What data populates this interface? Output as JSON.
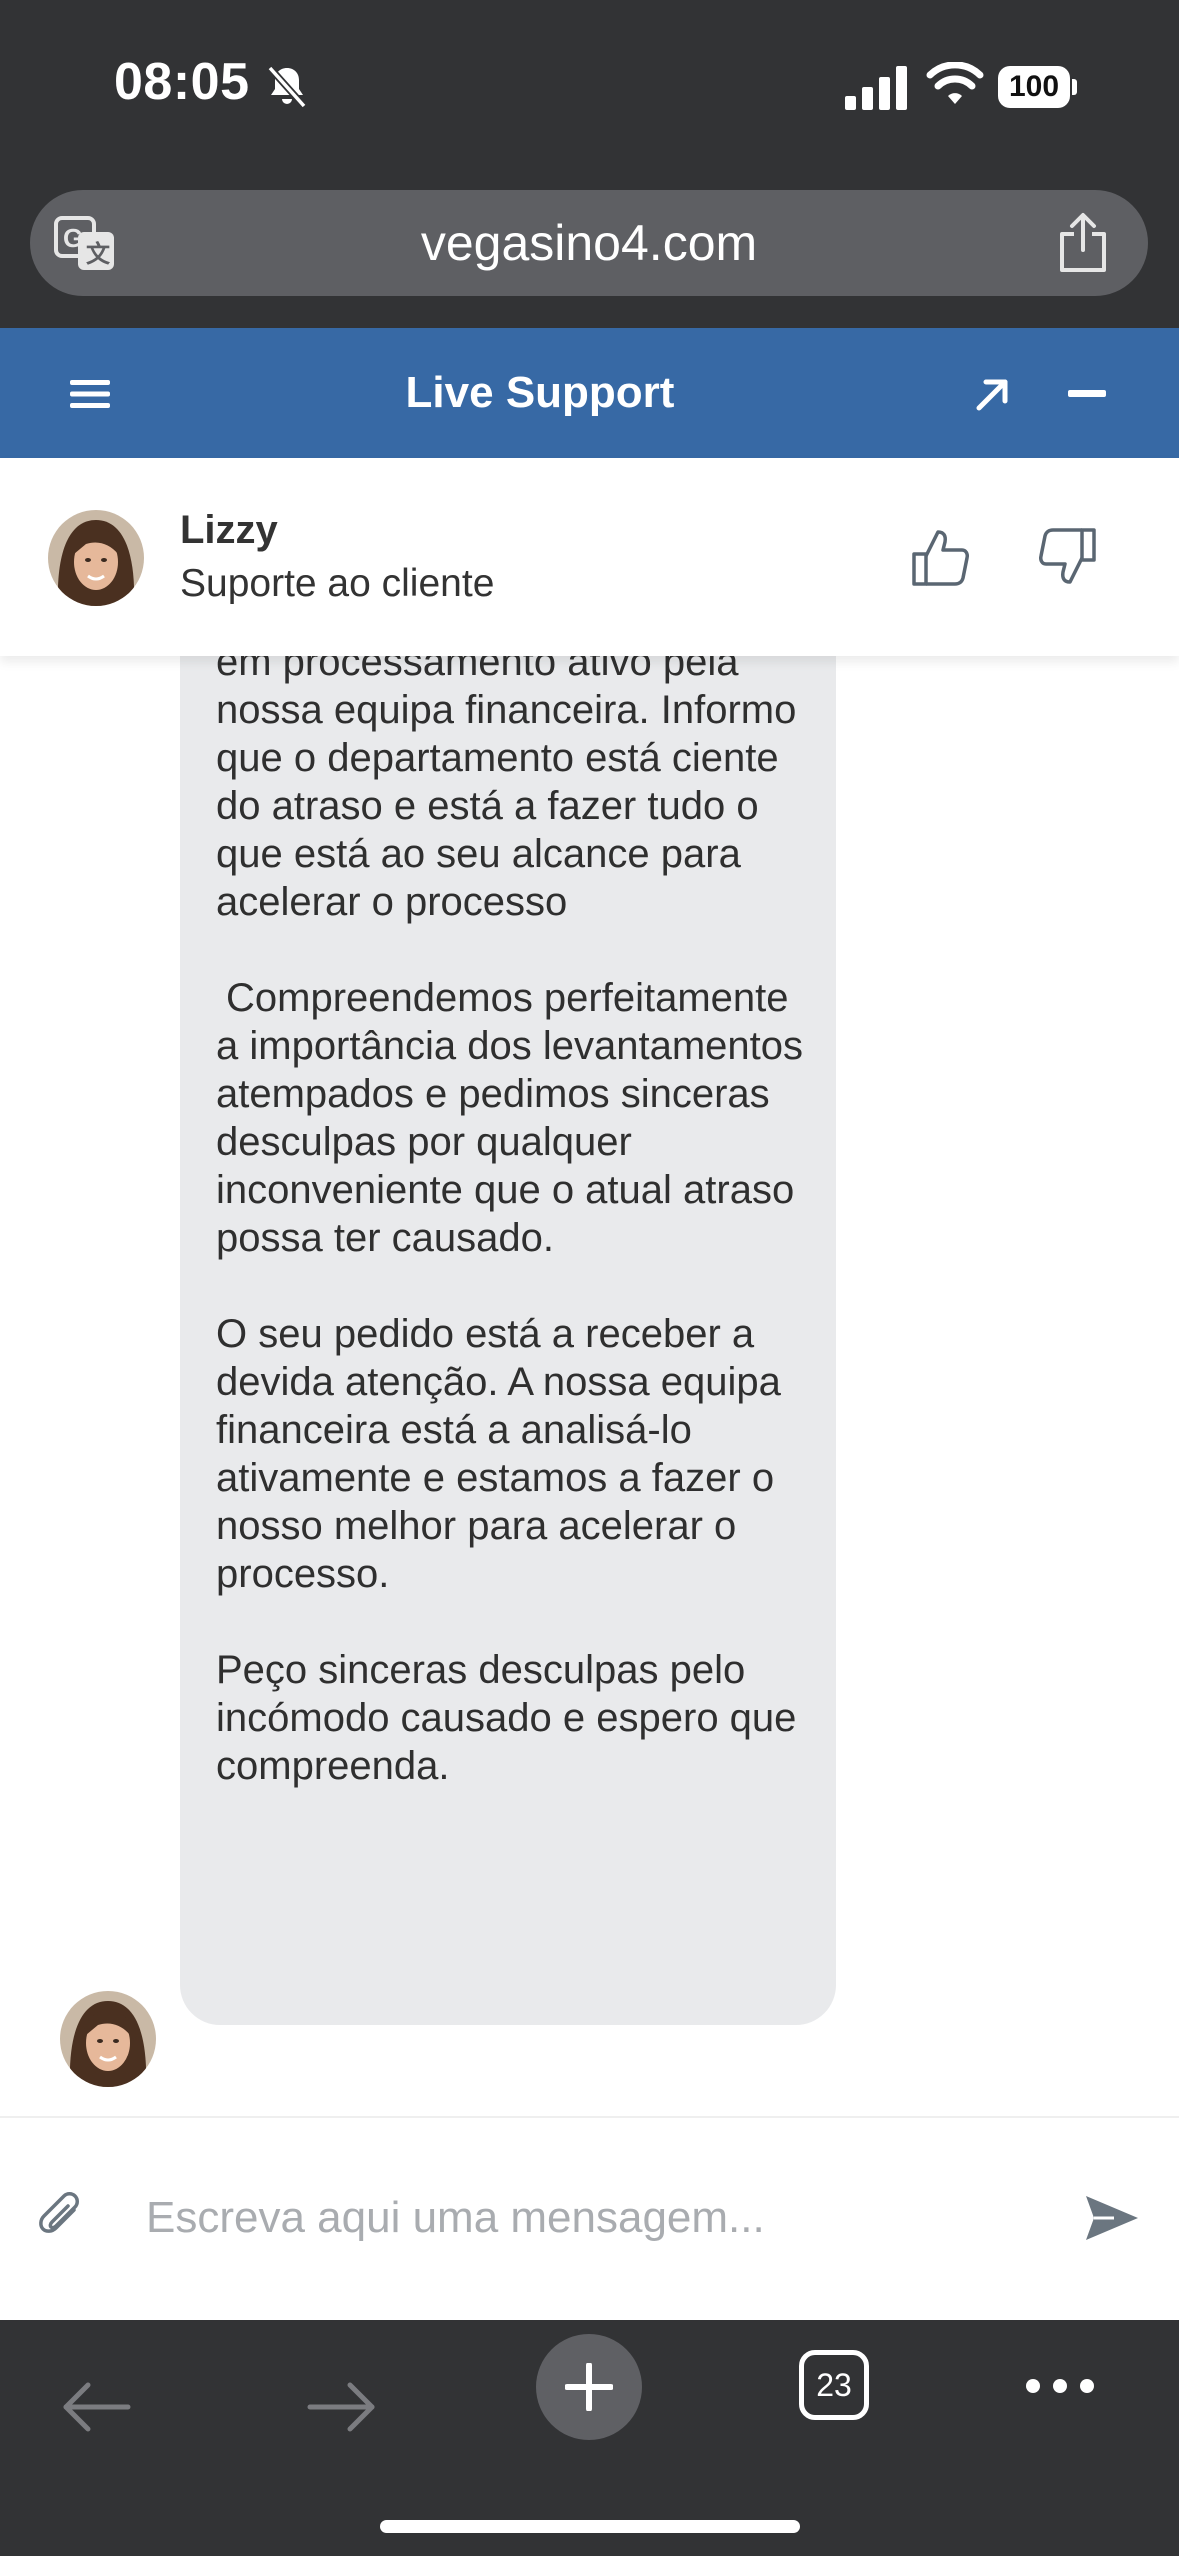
{
  "status_bar": {
    "time": "08:05",
    "battery": "100"
  },
  "browser": {
    "url": "vegasino4.com",
    "tab_count": "23"
  },
  "chat": {
    "header_title": "Live Support",
    "agent": {
      "name": "Lizzy",
      "role": "Suporte ao cliente"
    },
    "message": {
      "paragraphs": [
        "pagamentos estão atualmente em processamento ativo pela nossa equipa financeira. Informo que o departamento está ciente do atraso e está a fazer tudo o que está ao seu alcance para acelerar o processo",
        "Compreendemos perfeitamente a importância dos levantamentos atempados e pedimos sinceras desculpas por qualquer inconveniente que o atual atraso possa ter causado.",
        "O seu pedido está a receber a devida atenção. A nossa equipa financeira está a analisá-lo ativamente e estamos a fazer o nosso melhor para acelerar o processo.",
        "Peço sinceras desculpas pelo incómodo causado e espero que compreenda."
      ]
    },
    "composer": {
      "placeholder": "Escreva aqui uma mensagem..."
    }
  },
  "icons": {
    "status": [
      "bell-slash-icon",
      "signal-icon",
      "wifi-icon",
      "battery-icon"
    ],
    "browser": [
      "translate-icon",
      "share-icon",
      "back-icon",
      "forward-icon",
      "plus-icon",
      "tabs-icon",
      "more-icon"
    ],
    "chat": [
      "menu-icon",
      "expand-icon",
      "minimize-icon",
      "thumbs-up-icon",
      "thumbs-down-icon",
      "paperclip-icon",
      "send-icon"
    ]
  },
  "colors": {
    "header_blue": "#3769a5",
    "chrome_dark": "#323335",
    "bubble_gray": "#e9eaec"
  }
}
